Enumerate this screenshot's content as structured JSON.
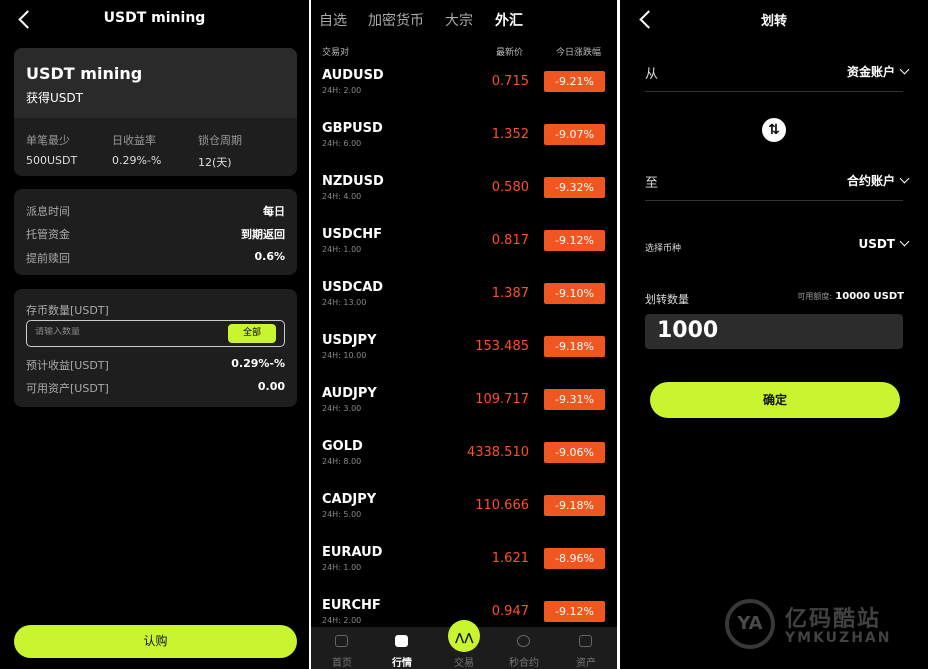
{
  "mining": {
    "title": "USDT mining",
    "card_title": "USDT mining",
    "card_subtitle": "获得USDT",
    "stats": [
      {
        "label": "单笔最少",
        "value": "500USDT"
      },
      {
        "label": "日收益率",
        "value": "0.29%-%"
      },
      {
        "label": "锁仓周期",
        "value": "12(天)"
      }
    ],
    "info": [
      {
        "label": "派息时间",
        "value": "每日"
      },
      {
        "label": "托管资金",
        "value": "到期返回"
      },
      {
        "label": "提前赎回",
        "value": "0.6%"
      }
    ],
    "deposit_label": "存币数量[USDT]",
    "deposit_placeholder": "请输入数量",
    "all_button": "全部",
    "expected_label": "预计收益[USDT]",
    "expected_value": "0.29%-%",
    "available_label": "可用资产[USDT]",
    "available_value": "0.00",
    "subscribe_button": "认购"
  },
  "market": {
    "tabs": [
      "自选",
      "加密货币",
      "大宗",
      "外汇"
    ],
    "active_tab": 3,
    "headers": {
      "pair": "交易对",
      "price": "最新价",
      "change": "今日涨跌幅"
    },
    "rows": [
      {
        "pair": "AUDUSD",
        "vol": "24H: 2.00",
        "price": "0.715",
        "change": "-9.21%"
      },
      {
        "pair": "GBPUSD",
        "vol": "24H: 6.00",
        "price": "1.352",
        "change": "-9.07%"
      },
      {
        "pair": "NZDUSD",
        "vol": "24H: 4.00",
        "price": "0.580",
        "change": "-9.32%"
      },
      {
        "pair": "USDCHF",
        "vol": "24H: 1.00",
        "price": "0.817",
        "change": "-9.12%"
      },
      {
        "pair": "USDCAD",
        "vol": "24H: 13.00",
        "price": "1.387",
        "change": "-9.10%"
      },
      {
        "pair": "USDJPY",
        "vol": "24H: 10.00",
        "price": "153.485",
        "change": "-9.18%"
      },
      {
        "pair": "AUDJPY",
        "vol": "24H: 3.00",
        "price": "109.717",
        "change": "-9.31%"
      },
      {
        "pair": "GOLD",
        "vol": "24H: 8.00",
        "price": "4338.510",
        "change": "-9.06%"
      },
      {
        "pair": "CADJPY",
        "vol": "24H: 5.00",
        "price": "110.666",
        "change": "-9.18%"
      },
      {
        "pair": "EURAUD",
        "vol": "24H: 1.00",
        "price": "1.621",
        "change": "-8.96%"
      },
      {
        "pair": "EURCHF",
        "vol": "24H: 2.00",
        "price": "0.947",
        "change": "-9.12%"
      }
    ],
    "nav": [
      {
        "label": "首页",
        "icon": "home-icon"
      },
      {
        "label": "行情",
        "icon": "chart-icon"
      },
      {
        "label": "交易",
        "icon": "trade-icon"
      },
      {
        "label": "秒合约",
        "icon": "contract-icon"
      },
      {
        "label": "资产",
        "icon": "wallet-icon"
      }
    ],
    "active_nav": 1
  },
  "transfer": {
    "title": "划转",
    "from_label": "从",
    "from_value": "资金账户",
    "to_label": "至",
    "to_value": "合约账户",
    "currency_label": "选择币种",
    "currency_value": "USDT",
    "amount_label": "划转数量",
    "available_label": "可用额度:",
    "available_value": "10000 USDT",
    "amount_value": "1000",
    "confirm_button": "确定"
  },
  "watermark": {
    "cn": "亿码酷站",
    "en": "YMKUZHAN",
    "logo": "YA"
  },
  "colors": {
    "accent": "#c8f530",
    "down": "#ff4e2a",
    "badge": "#f0561f",
    "background": "#000000",
    "card": "#1e1e1e"
  }
}
